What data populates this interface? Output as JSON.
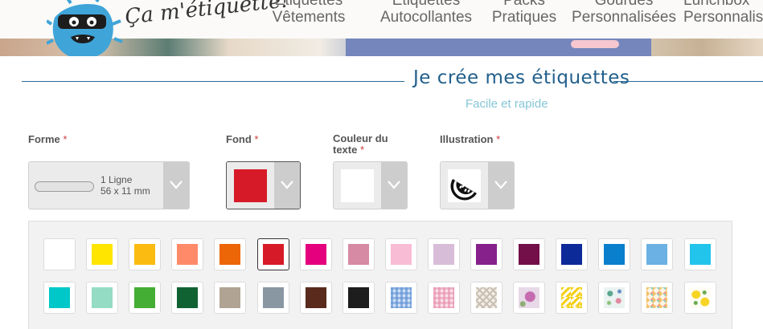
{
  "header": {
    "logo_text": "Ça m'étiquette!",
    "nav": [
      {
        "line1": "Étiquettes",
        "line2": "Vêtements"
      },
      {
        "line1": "Étiquettes",
        "line2": "Autocollantes"
      },
      {
        "line1": "Packs",
        "line2": "Pratiques"
      },
      {
        "line1": "Gourdes",
        "line2": "Personnalisées"
      },
      {
        "line1": "Lunchbox",
        "line2": "Personnalisées"
      }
    ]
  },
  "page": {
    "title": "Je crée mes étiquettes",
    "subtitle": "Facile et rapide"
  },
  "fields": {
    "forme": {
      "label": "Forme",
      "required": "*",
      "value_line1": "1 Ligne",
      "value_line2": "56 x 11 mm"
    },
    "fond": {
      "label": "Fond",
      "required": "*",
      "value_color": "#d71a28"
    },
    "couleur_texte": {
      "label_line1": "Couleur du",
      "label_line2": "texte",
      "required": "*",
      "value_color": "#ffffff"
    },
    "illustration": {
      "label": "Illustration",
      "required": "*",
      "value_icon": "watermelon-icon"
    }
  },
  "palette": {
    "row1": [
      {
        "name": "white",
        "color": "#ffffff"
      },
      {
        "name": "yellow",
        "color": "#ffe500"
      },
      {
        "name": "amber",
        "color": "#fbbb10"
      },
      {
        "name": "salmon",
        "color": "#ff8a6a"
      },
      {
        "name": "orange",
        "color": "#ec6608"
      },
      {
        "name": "red",
        "color": "#d71a28",
        "selected": true
      },
      {
        "name": "magenta",
        "color": "#e5007e"
      },
      {
        "name": "old-rose",
        "color": "#d68aa3"
      },
      {
        "name": "light-pink",
        "color": "#f8bcd5"
      },
      {
        "name": "lilac",
        "color": "#d8bdd8"
      },
      {
        "name": "purple",
        "color": "#86218b"
      },
      {
        "name": "plum",
        "color": "#731049"
      },
      {
        "name": "navy",
        "color": "#0d2a99"
      },
      {
        "name": "blue",
        "color": "#0a7fcc"
      },
      {
        "name": "sky-blue",
        "color": "#6bb1e3"
      },
      {
        "name": "cyan",
        "color": "#22c4ec"
      }
    ],
    "row2": [
      {
        "name": "turquoise",
        "color": "#00c8c8"
      },
      {
        "name": "mint",
        "color": "#94dcc4"
      },
      {
        "name": "green",
        "color": "#44ad34"
      },
      {
        "name": "dark-green",
        "color": "#116232"
      },
      {
        "name": "taupe",
        "color": "#b1a393"
      },
      {
        "name": "slate",
        "color": "#8997a3"
      },
      {
        "name": "brown",
        "color": "#5a2a1c"
      },
      {
        "name": "black",
        "color": "#1d1d1d"
      },
      {
        "name": "gingham-blue",
        "pattern": "pat-gingham-blue"
      },
      {
        "name": "gingham-pink",
        "pattern": "pat-gingham-pink"
      },
      {
        "name": "geometric",
        "pattern": "pat-geo"
      },
      {
        "name": "floral-pink",
        "pattern": "pat-floral-pink"
      },
      {
        "name": "chevron-yellow",
        "pattern": "pat-chevron"
      },
      {
        "name": "leaves",
        "pattern": "pat-leaves"
      },
      {
        "name": "harlequin",
        "pattern": "pat-harlequin"
      },
      {
        "name": "lemons",
        "pattern": "pat-lemons"
      }
    ]
  }
}
